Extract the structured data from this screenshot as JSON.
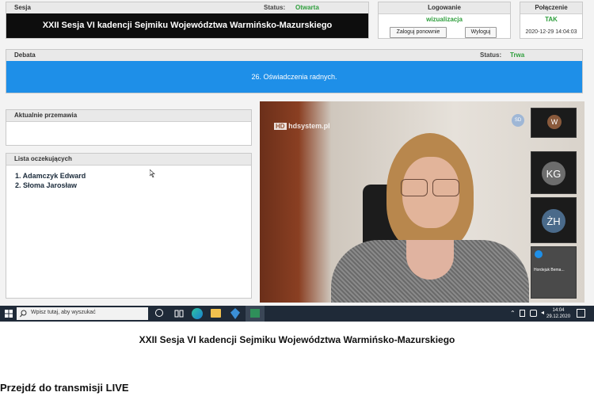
{
  "session": {
    "header": "Sesja",
    "status_label": "Status:",
    "status_value": "Otwarta",
    "title": "XXII Sesja VI kadencji Sejmiku Województwa Warmińsko-Mazurskiego"
  },
  "login": {
    "header": "Logowanie",
    "mode": "wizualizacja",
    "relogin_button": "Zaloguj ponownie",
    "logout_button": "Wyloguj"
  },
  "connection": {
    "header": "Połączenie",
    "value": "TAK",
    "datetime": "2020-12-29 14:04:03"
  },
  "debate": {
    "header": "Debata",
    "status_label": "Status:",
    "status_value": "Trwa",
    "current_item": "26. Oświadczenia radnych."
  },
  "speaking": {
    "header": "Aktualnie przemawia"
  },
  "waiting": {
    "header": "Lista oczekujących",
    "items": [
      "1. Adamczyk Edward",
      "2. Słoma Jarosław"
    ]
  },
  "video": {
    "watermark": "hdsystem.pl",
    "self_badge": "SD",
    "tiles": [
      {
        "initials": "W",
        "color": "#8a5a3c"
      },
      {
        "initials": "KG",
        "color": "#6d6d6d"
      },
      {
        "initials": "ŻH",
        "color": "#4a6a8a"
      },
      {
        "initials": "",
        "name": "Hordejuk Bema..."
      }
    ]
  },
  "taskbar": {
    "search_placeholder": "Wpisz tutaj, aby wyszukać",
    "time": "14:04",
    "date": "29.12.2020"
  },
  "caption": "XXII Sesja VI kadencji Sejmiku Województwa Warmińsko-Mazurskiego",
  "live_link": "Przejdź do transmisji LIVE",
  "colors": {
    "accent_blue": "#1e8fe8",
    "status_green": "#2e9e3c",
    "title_bg": "#0d0d0d"
  }
}
